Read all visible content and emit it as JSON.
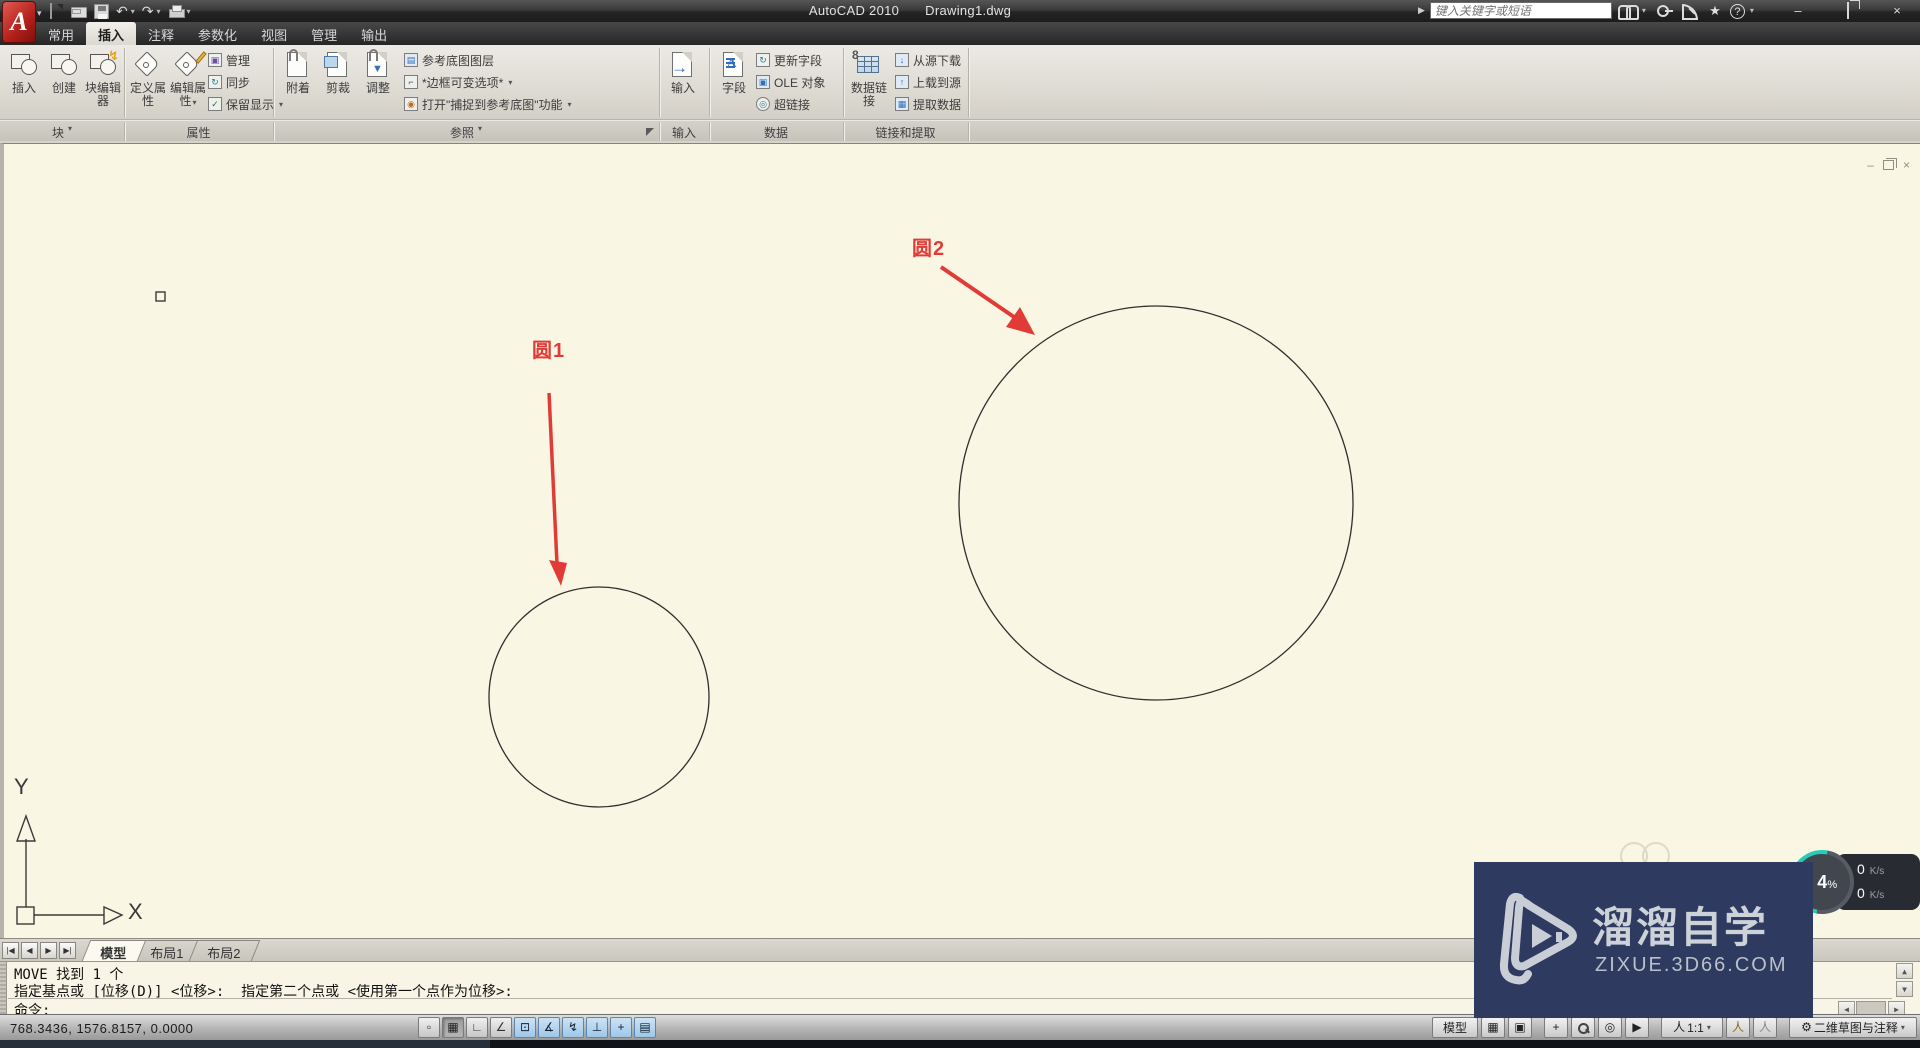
{
  "titlebar": {
    "app_title": "AutoCAD 2010",
    "doc_title": "Drawing1.dwg"
  },
  "search": {
    "placeholder": "键入关键字或短语"
  },
  "tabs": {
    "t0": "常用",
    "t1": "插入",
    "t2": "注释",
    "t3": "参数化",
    "t4": "视图",
    "t5": "管理",
    "t6": "输出"
  },
  "panels": {
    "block": {
      "label": "块",
      "b0": "插入",
      "b1": "创建",
      "b2": "块编辑器"
    },
    "attr": {
      "label": "属性",
      "b0": "定义属性",
      "b1": "编辑属性",
      "s0": "管理",
      "s1": "同步",
      "s2": "保留显示"
    },
    "ref": {
      "label": "参照",
      "b0": "附着",
      "b1": "剪裁",
      "b2": "调整",
      "s0": "参考底图图层",
      "s1": "*边框可变选项*",
      "s2": "打开\"捕捉到参考底图\"功能"
    },
    "imp": {
      "label": "输入",
      "b0": "输入"
    },
    "data": {
      "label": "数据",
      "b0": "字段",
      "s0": "更新字段",
      "s1": "OLE 对象",
      "s2": "超链接"
    },
    "link": {
      "label": "链接和提取",
      "b0": "数据链接",
      "s0": "从源下载",
      "s1": "上载到源",
      "s2": "提取数据"
    }
  },
  "canvas": {
    "circle1_label": "圆1",
    "circle2_label": "圆2",
    "axis_x": "X",
    "axis_y": "Y"
  },
  "layout": {
    "model": "模型",
    "l1": "布局1",
    "l2": "布局2"
  },
  "command": {
    "h1": "MOVE 找到 1 个",
    "h2": "指定基点或 [位移(D)] <位移>:  指定第二个点或 <使用第一个点作为位移>:",
    "prompt": "命令:"
  },
  "status": {
    "coords": "768.3436,  1576.8157,  0.0000",
    "model": "模型",
    "scale": "1:1",
    "workspace": "二维草图与注释"
  },
  "watermark": {
    "name": "溜溜自学",
    "site": "zixue.3d66.com"
  },
  "net": {
    "percent": "4",
    "percent_unit": "%",
    "up": "0",
    "down": "0",
    "unit": "K/s"
  },
  "colors": {
    "annotation_red": "#e23b37",
    "canvas_bg": "#f9f6e4",
    "watermark_bg": "#2e3a60",
    "toggle_active": "#9ec7e8"
  },
  "icons": {
    "app_logo": "A",
    "caret_down": "▾",
    "undo": "↶",
    "redo": "↷",
    "star": "★",
    "help": "?",
    "minimize": "–",
    "close": "×",
    "collapse_right": "▶",
    "nav_first": "◀",
    "nav_prev": "◀",
    "nav_next": "▶",
    "nav_last": "▶",
    "scroll_up": "▲",
    "scroll_down": "▼",
    "scroll_left": "◀",
    "scroll_right": "▶",
    "snap": "▫",
    "grid": "▦",
    "ortho": "∟",
    "polar": "∠",
    "osnap": "⊡",
    "osnap_3d": "∡",
    "otrack": "↯",
    "ducs": "⊥",
    "dyn": "+",
    "quick_props": "▤",
    "gear": "⚙",
    "person": "人",
    "up_arrow": "↑",
    "down_arrow": "↓",
    "qv_layouts": "▦",
    "qv_drawings": "▣",
    "pan": "+",
    "wheel": "◎",
    "showmotion": "▶",
    "sync": "↻",
    "check": "✓",
    "flash": "↯",
    "import_arrow": "→",
    "vp_minimize": "–",
    "vp_close": "×"
  }
}
